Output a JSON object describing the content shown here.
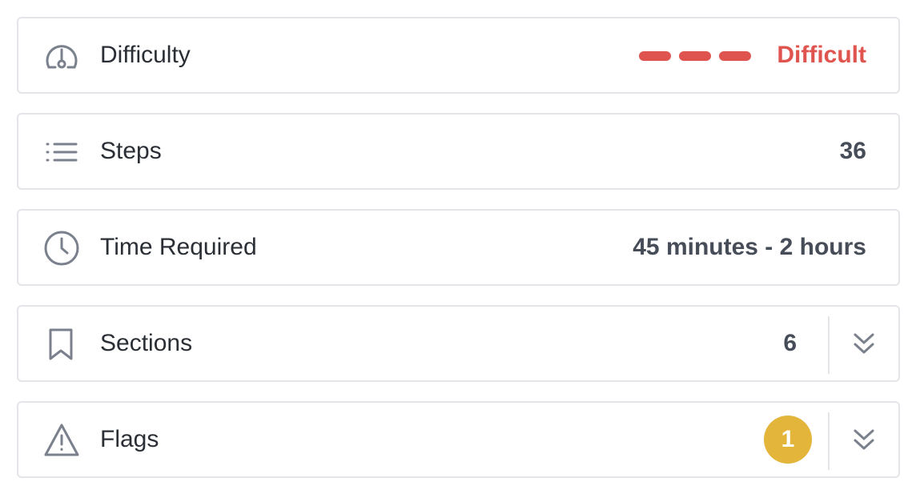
{
  "colors": {
    "difficulty_accent": "#e0544f",
    "badge_background": "#e3b53a",
    "icon_color": "#7a808c",
    "border": "#e3e5e8"
  },
  "rows": [
    {
      "id": "difficulty",
      "icon": "gauge-icon",
      "label": "Difficulty",
      "value": "Difficult",
      "difficulty_level": 3,
      "difficulty_max": 3
    },
    {
      "id": "steps",
      "icon": "list-icon",
      "label": "Steps",
      "value": "36"
    },
    {
      "id": "time",
      "icon": "clock-icon",
      "label": "Time Required",
      "value": "45 minutes - 2 hours"
    },
    {
      "id": "sections",
      "icon": "bookmark-icon",
      "label": "Sections",
      "value": "6",
      "expand_icon": "chevron-double-down-icon"
    },
    {
      "id": "flags",
      "icon": "warning-icon",
      "label": "Flags",
      "value": "1",
      "expand_icon": "chevron-double-down-icon"
    }
  ]
}
